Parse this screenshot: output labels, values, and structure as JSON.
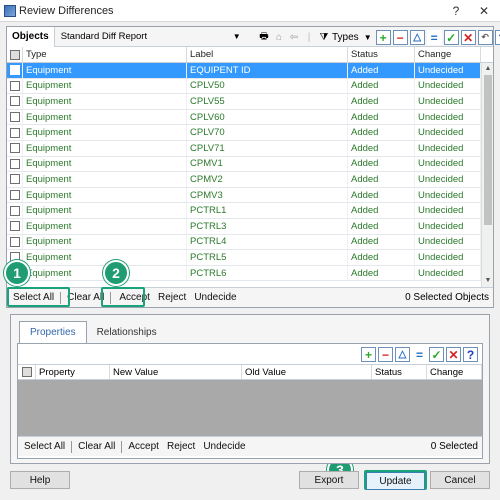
{
  "window": {
    "title": "Review Differences",
    "help_btn": "?",
    "close_btn": "✕"
  },
  "objects": {
    "tab_label": "Objects",
    "report_select": "Standard  Diff  Report",
    "types_label": "Types",
    "columns": [
      "Type",
      "Label",
      "Status",
      "Change"
    ],
    "rows": [
      {
        "type": "Equipment",
        "label": "EQUIPENT ID",
        "status": "Added",
        "change": "Undecided",
        "selected": true
      },
      {
        "type": "Equipment",
        "label": "CPLV50",
        "status": "Added",
        "change": "Undecided"
      },
      {
        "type": "Equipment",
        "label": "CPLV55",
        "status": "Added",
        "change": "Undecided"
      },
      {
        "type": "Equipment",
        "label": "CPLV60",
        "status": "Added",
        "change": "Undecided"
      },
      {
        "type": "Equipment",
        "label": "CPLV70",
        "status": "Added",
        "change": "Undecided"
      },
      {
        "type": "Equipment",
        "label": "CPLV71",
        "status": "Added",
        "change": "Undecided"
      },
      {
        "type": "Equipment",
        "label": "CPMV1",
        "status": "Added",
        "change": "Undecided"
      },
      {
        "type": "Equipment",
        "label": "CPMV2",
        "status": "Added",
        "change": "Undecided"
      },
      {
        "type": "Equipment",
        "label": "CPMV3",
        "status": "Added",
        "change": "Undecided"
      },
      {
        "type": "Equipment",
        "label": "PCTRL1",
        "status": "Added",
        "change": "Undecided"
      },
      {
        "type": "Equipment",
        "label": "PCTRL3",
        "status": "Added",
        "change": "Undecided"
      },
      {
        "type": "Equipment",
        "label": "PCTRL4",
        "status": "Added",
        "change": "Undecided"
      },
      {
        "type": "Equipment",
        "label": "PCTRL5",
        "status": "Added",
        "change": "Undecided"
      },
      {
        "type": "Equipment",
        "label": "PCTRL6",
        "status": "Added",
        "change": "Undecided"
      }
    ],
    "footer": {
      "select_all": "Select All",
      "clear_all": "Clear All",
      "accept": "Accept",
      "reject": "Reject",
      "undecide": "Undecide",
      "selected_count": "0 Selected Objects"
    }
  },
  "properties": {
    "tabs": [
      "Properties",
      "Relationships"
    ],
    "columns": [
      "Property",
      "New Value",
      "Old Value",
      "Status",
      "Change"
    ],
    "footer": {
      "select_all": "Select All",
      "clear_all": "Clear All",
      "accept": "Accept",
      "reject": "Reject",
      "undecide": "Undecide",
      "selected_count": "0 Selected"
    }
  },
  "buttons": {
    "help": "Help",
    "export": "Export",
    "update": "Update",
    "cancel": "Cancel"
  },
  "steps": [
    "1",
    "2",
    "3"
  ],
  "colors": {
    "highlight": "#1aa37a",
    "selected_row": "#3399ff",
    "row_text": "#2a7a2a"
  }
}
